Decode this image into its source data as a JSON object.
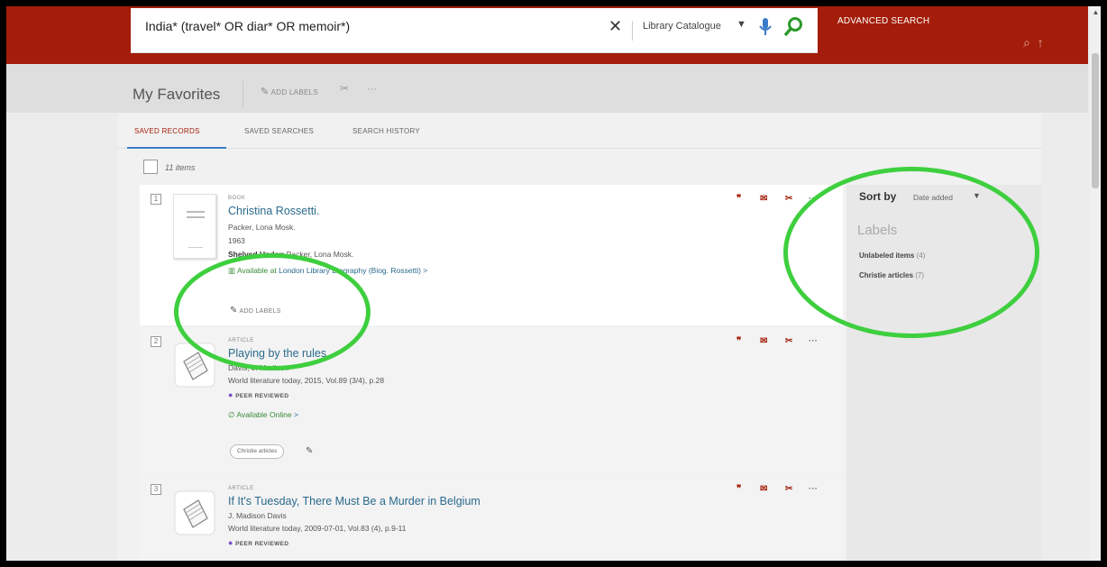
{
  "search": {
    "query": "India* (travel* OR diar* OR memoir*)",
    "scope": "Library Catalogue",
    "advanced_label": "ADVANCED SEARCH",
    "colors": {
      "brand": "#a31d0a",
      "link": "#2a6a8c",
      "available": "#3a8a3a",
      "annotation": "#3ecf3e"
    }
  },
  "favorites": {
    "title": "My Favorites",
    "add_labels": "ADD LABELS",
    "more": "···"
  },
  "tabs": [
    {
      "label": "SAVED RECORDS",
      "active": true
    },
    {
      "label": "SAVED SEARCHES",
      "active": false
    },
    {
      "label": "SEARCH HISTORY",
      "active": false
    }
  ],
  "select_all": {
    "count_label": "11 items"
  },
  "records": [
    {
      "num": "1",
      "type": "BOOK",
      "title": "Christina Rossetti.",
      "author": "Packer, Lona Mosk.",
      "year": "1963",
      "shelved_prefix": "Shelved Under:",
      "shelved_value": "Packer, Lona Mosk.",
      "avail_prefix": "Available at",
      "avail_loc": "London Library  Biography (Biog. Rossetti)",
      "avail_arrow": ">",
      "add_labels": "ADD LABELS"
    },
    {
      "num": "2",
      "type": "ARTICLE",
      "title": "Playing by the rules",
      "author": "Davis, J. Madison",
      "source": "World literature today, 2015, Vol.89 (3/4), p.28",
      "peer": "PEER REVIEWED",
      "avail": "Available Online",
      "avail_arrow": ">",
      "chip": "Christie articles"
    },
    {
      "num": "3",
      "type": "ARTICLE",
      "title": "If It's Tuesday, There Must Be a Murder in Belgium",
      "author": "J. Madison Davis",
      "source": "World literature today, 2009-07-01, Vol.83 (4), p.9-11",
      "peer": "PEER REVIEWED"
    }
  ],
  "sidebar": {
    "sort_label": "Sort by",
    "sort_value": "Date added",
    "labels_heading": "Labels",
    "labels": [
      {
        "name": "Unlabeled items",
        "count": "(4)"
      },
      {
        "name": "Christie articles",
        "count": "(7)"
      }
    ]
  }
}
